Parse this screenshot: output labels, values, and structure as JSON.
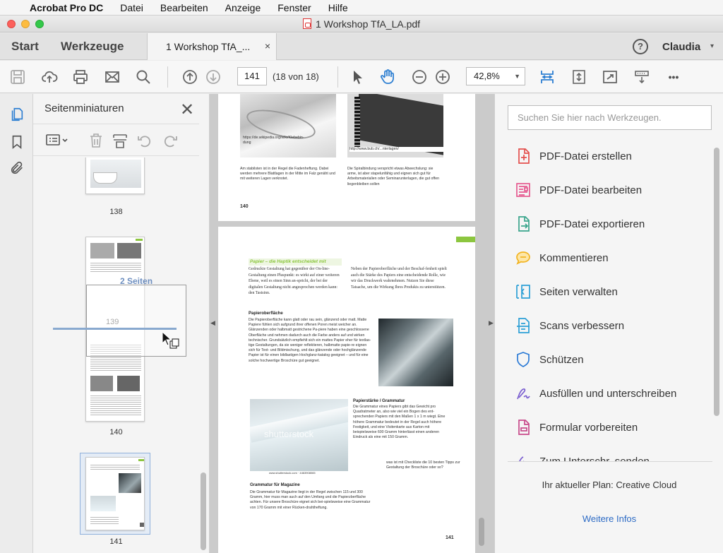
{
  "menubar": {
    "app": "Acrobat Pro DC",
    "items": [
      "Datei",
      "Bearbeiten",
      "Anzeige",
      "Fenster",
      "Hilfe"
    ]
  },
  "window": {
    "title": "1  Workshop TfA_LA.pdf"
  },
  "tabs": {
    "start": "Start",
    "tools": "Werkzeuge",
    "document": "1  Workshop TfA_...",
    "close": "×",
    "help": "?",
    "user": "Claudia"
  },
  "toolbar": {
    "page_value": "141",
    "page_count": "(18 von 18)",
    "zoom": "42,8%",
    "more": "•••"
  },
  "thumbnails": {
    "title": "Seitenminiaturen",
    "close": "✕",
    "pages": [
      {
        "label": "138"
      },
      {
        "label": "140"
      },
      {
        "label": "141"
      }
    ],
    "drag_label": "2 Seiten",
    "ghost_page": "139"
  },
  "document": {
    "page1": {
      "url_left": "https://de.wikipedia.org/wiki/Klebebin-\ndung",
      "url_right": "http://www.bub.ch/...nterlagen/",
      "col_left": "Am stabilsten ist in der Regel die Fadenheftung. Dabei werden mehrere Blattlagen in der Mitte im Falz genäht und mit weiteren Lagen verknotet.",
      "col_right": "Die Spiralbindung verspricht etwas Abwechslung: sie arme, ist aber stapelunfähig und eignen sich gut für Arbeitsmaterialien oder Seminarunterlagen, die gut offen liegenbleiben sollen",
      "page_number": "140"
    },
    "page2": {
      "headline": "Papier – die Haptik entscheidet mit",
      "intro_left": "Gedruckte Gestaltung hat gegenüber der On-line-Gestaltung einen Pluspunkt: es wirkt auf einer weiteren Ebene, weil es einen Sinn an-spricht, der bei der digitalen Gestaltung nicht angesprochen werden kann: den Tastsinn.",
      "intro_right": "Neben der Papieroberfläche und der Beschaf-fenheit spielt auch die Stärke des Papiers eine entscheidende Rolle, wie wir das Druckwerk wahrnehmen. Nutzen Sie diese Tatsache, um die Wirkung Ihres Produkts zu unterstützen.",
      "sub1": "Papieroberfläche",
      "body1": "Die Papieroberfläche kann glatt oder rau sein, glänzend oder matt. Matte Papiere fühlen sich aufgrund ihrer offenen Poren meist weicher an. Glänzenden oder halbmatt gestrichene Pa-piere haben eine geschlossene Oberfläche und nehmen dadurch auch die Farbe anders auf und wirken technischer. Grundsätzlich empfiehlt sich ein mattes Papier eher für textlas-tige Gestaltungen, da sie weniger reflektieren, halbmatte papie-re eignen sich für Text- und Bildmischung, und das glänzende oder hochglänzende Papier ist für einen bildlastigen Hochglanz-katalog geeignet – und für eine solche hochwertige Broschüre gut geeignet.",
      "sub2": "Papierstärke / Grammatur",
      "body2": "Die Grammatur eines Papiers gibt das Gewicht pro Quadratmeter an, also wie viel ein Bogen des ent-sprechenden Papiers mit den Maßen 1 x 1 m wiegt. Eine höhere Grammatur bedeutet in der Regel auch höhere Festigkeit, und eine Visitenkarte aus Karton mit beispielsweise 600 Gramm hinterlässt einen anderen Eindruck als eine mit 150 Gramm.",
      "caption": "www.shutterstock.com · 4463908065",
      "side_note": "was ist mit Checkliste die 10 besten Tipps zur Gestaltung der Broschüre oder so?",
      "sub3": "Grammatur für Magazine",
      "body3": "Die Grammatur für Magazine liegt in der Regel zwischen 115 und 300 Gramm, hier muss man auch auf den Umfang und die Papierzberfläche achten. Für unsere Broschüre eignet sich bei-spielsweise eine Grammatur von 170 Gramm mit einer Rücken-drahtheftung.",
      "watermark": "shutterstock",
      "page_number": "141"
    }
  },
  "tools_panel": {
    "search_placeholder": "Suchen Sie hier nach Werkzeugen.",
    "items": [
      {
        "label": "PDF-Datei erstellen",
        "icon": "create-pdf-icon",
        "color": "#e3504d"
      },
      {
        "label": "PDF-Datei bearbeiten",
        "icon": "edit-pdf-icon",
        "color": "#e5598f"
      },
      {
        "label": "PDF-Datei exportieren",
        "icon": "export-pdf-icon",
        "color": "#3aa58c"
      },
      {
        "label": "Kommentieren",
        "icon": "comment-icon",
        "color": "#f2b320"
      },
      {
        "label": "Seiten verwalten",
        "icon": "organize-pages-icon",
        "color": "#2c9fd6"
      },
      {
        "label": "Scans verbessern",
        "icon": "enhance-scans-icon",
        "color": "#2c9fd6"
      },
      {
        "label": "Schützen",
        "icon": "protect-shield-icon",
        "color": "#2c7bd6"
      },
      {
        "label": "Ausfüllen und unterschreiben",
        "icon": "fill-sign-icon",
        "color": "#7b5fd0"
      },
      {
        "label": "Formular vorbereiten",
        "icon": "prepare-form-icon",
        "color": "#c84a8b"
      },
      {
        "label": "Zum Unterschr. senden",
        "icon": "send-for-signature-icon",
        "color": "#7b5fd0"
      }
    ],
    "plan": "Ihr aktueller Plan: Creative Cloud",
    "more_info": "Weitere Infos"
  }
}
